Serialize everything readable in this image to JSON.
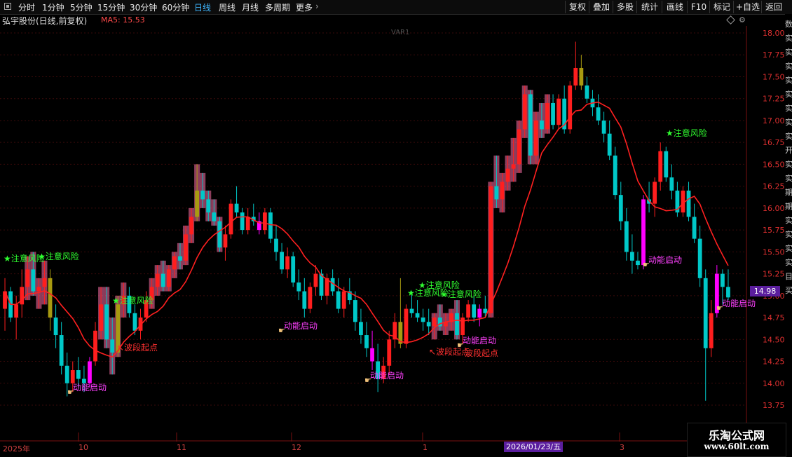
{
  "toolbar": {
    "periods": [
      "分时",
      "1分钟",
      "5分钟",
      "15分钟",
      "30分钟",
      "60分钟",
      "日线",
      "周线",
      "月线",
      "多周期",
      "更多"
    ],
    "active_period": "日线",
    "right_buttons": [
      "复权",
      "叠加",
      "多股",
      "统计",
      "画线",
      "F10",
      "标记",
      "+自选",
      "返回"
    ]
  },
  "stock": {
    "title": "弘宇股份(日线,前复权)",
    "ma_label": "MA5: 15.53",
    "var_label": "VAR1"
  },
  "current_price": "14.98",
  "current_date": "2026/01/23/五",
  "x_axis": [
    "2025年",
    "10",
    "11",
    "12",
    "1",
    "2026/01/23/五",
    "3"
  ],
  "signals": {
    "risk": "★注意风险",
    "start": "动能启动",
    "wave": "↖波段起点",
    "wave2": "波段起点"
  },
  "watermark": {
    "title": "乐淘公式网",
    "url": "www.60lt.com"
  },
  "right_strip_chars": [
    "数",
    "实",
    "实",
    "实",
    "实",
    "实",
    "实",
    "实",
    "实",
    "开",
    "实",
    "实",
    "期",
    "期",
    "实",
    "实",
    "实",
    "实",
    "目",
    "买"
  ],
  "colors": {
    "up": "#ff1e1e",
    "down": "#00c8c8",
    "pink": "#ff6fa8",
    "olive": "#a89a10",
    "magenta": "#ff00ff",
    "ma": "#ff2020",
    "grid": "#3a0a0a"
  },
  "chart_data": {
    "type": "candlestick",
    "y_axis_ticks": [
      18.0,
      17.75,
      17.5,
      17.25,
      17.0,
      16.75,
      16.5,
      16.25,
      16.0,
      15.75,
      15.5,
      15.25,
      15.0,
      14.75,
      14.5,
      14.25,
      14.0,
      13.75
    ],
    "ylim": [
      13.6,
      18.1
    ],
    "series": [
      {
        "name": "MA5"
      }
    ],
    "candles": [
      [
        14.85,
        15.2,
        14.6,
        15.05
      ],
      [
        15.05,
        15.1,
        14.7,
        14.75
      ],
      [
        14.75,
        15.0,
        14.5,
        14.9
      ],
      [
        14.9,
        15.3,
        14.75,
        15.1
      ],
      [
        15.1,
        15.45,
        14.95,
        15.3
      ],
      [
        15.3,
        15.5,
        15.0,
        15.05
      ],
      [
        15.05,
        15.2,
        14.85,
        15.1
      ],
      [
        15.1,
        15.4,
        14.9,
        15.2
      ],
      [
        15.2,
        15.3,
        14.6,
        14.75
      ],
      [
        14.75,
        14.9,
        14.4,
        14.55
      ],
      [
        14.55,
        14.7,
        14.1,
        14.2
      ],
      [
        14.2,
        14.35,
        13.85,
        14.0
      ],
      [
        14.0,
        14.25,
        13.9,
        14.15
      ],
      [
        14.15,
        14.3,
        13.95,
        14.05
      ],
      [
        14.05,
        14.2,
        13.9,
        14.0
      ],
      [
        14.0,
        14.3,
        13.95,
        14.25
      ],
      [
        14.25,
        14.7,
        14.2,
        14.6
      ],
      [
        14.6,
        15.1,
        14.5,
        14.9
      ],
      [
        14.9,
        15.1,
        14.4,
        14.5
      ],
      [
        14.5,
        14.75,
        14.1,
        14.35
      ],
      [
        14.35,
        15.0,
        14.3,
        14.9
      ],
      [
        14.9,
        15.15,
        14.75,
        15.0
      ],
      [
        15.0,
        15.1,
        14.75,
        14.8
      ],
      [
        14.8,
        14.9,
        14.55,
        14.6
      ],
      [
        14.6,
        14.85,
        14.5,
        14.75
      ],
      [
        14.75,
        15.05,
        14.7,
        14.95
      ],
      [
        14.95,
        15.2,
        14.85,
        15.1
      ],
      [
        15.1,
        15.35,
        15.0,
        15.25
      ],
      [
        15.25,
        15.4,
        15.05,
        15.1
      ],
      [
        15.1,
        15.35,
        15.05,
        15.3
      ],
      [
        15.3,
        15.5,
        15.2,
        15.45
      ],
      [
        15.45,
        15.6,
        15.3,
        15.4
      ],
      [
        15.4,
        15.8,
        15.35,
        15.7
      ],
      [
        15.7,
        16.0,
        15.6,
        15.9
      ],
      [
        15.9,
        16.5,
        15.85,
        16.2
      ],
      [
        16.2,
        16.4,
        16.0,
        16.1
      ],
      [
        16.1,
        16.2,
        15.85,
        15.95
      ],
      [
        15.95,
        16.1,
        15.8,
        15.85
      ],
      [
        15.85,
        15.9,
        15.5,
        15.55
      ],
      [
        15.55,
        15.8,
        15.4,
        15.7
      ],
      [
        15.7,
        16.1,
        15.65,
        16.05
      ],
      [
        16.05,
        16.25,
        15.9,
        15.95
      ],
      [
        15.95,
        16.0,
        15.7,
        15.75
      ],
      [
        15.75,
        16.0,
        15.7,
        15.9
      ],
      [
        15.9,
        16.05,
        15.8,
        15.85
      ],
      [
        15.85,
        15.95,
        15.7,
        15.75
      ],
      [
        15.75,
        16.0,
        15.7,
        15.95
      ],
      [
        15.95,
        16.0,
        15.6,
        15.65
      ],
      [
        15.65,
        15.8,
        15.4,
        15.5
      ],
      [
        15.5,
        15.6,
        15.25,
        15.3
      ],
      [
        15.3,
        15.55,
        15.2,
        15.45
      ],
      [
        15.45,
        15.5,
        15.1,
        15.15
      ],
      [
        15.15,
        15.3,
        14.95,
        15.05
      ],
      [
        15.05,
        15.2,
        14.75,
        14.85
      ],
      [
        14.85,
        15.15,
        14.8,
        15.1
      ],
      [
        15.1,
        15.35,
        15.0,
        15.25
      ],
      [
        15.25,
        15.3,
        14.95,
        15.0
      ],
      [
        15.0,
        15.25,
        14.9,
        15.2
      ],
      [
        15.2,
        15.3,
        15.0,
        15.05
      ],
      [
        15.05,
        15.2,
        14.8,
        14.85
      ],
      [
        14.85,
        15.1,
        14.75,
        15.05
      ],
      [
        15.05,
        15.2,
        14.9,
        14.95
      ],
      [
        14.95,
        15.05,
        14.6,
        14.7
      ],
      [
        14.7,
        14.85,
        14.45,
        14.55
      ],
      [
        14.55,
        14.7,
        14.3,
        14.4
      ],
      [
        14.4,
        14.6,
        14.15,
        14.25
      ],
      [
        14.25,
        14.45,
        13.9,
        14.05
      ],
      [
        14.05,
        14.3,
        14.0,
        14.2
      ],
      [
        14.2,
        14.6,
        14.1,
        14.5
      ],
      [
        14.5,
        14.8,
        14.4,
        14.7
      ],
      [
        14.7,
        15.2,
        14.4,
        14.45
      ],
      [
        14.45,
        14.9,
        14.4,
        14.85
      ],
      [
        14.85,
        15.05,
        14.75,
        14.8
      ],
      [
        14.8,
        14.95,
        14.7,
        14.75
      ],
      [
        14.75,
        14.85,
        14.6,
        14.7
      ],
      [
        14.7,
        14.85,
        14.55,
        14.65
      ],
      [
        14.65,
        14.8,
        14.5,
        14.75
      ],
      [
        14.75,
        14.9,
        14.6,
        14.65
      ],
      [
        14.65,
        14.8,
        14.55,
        14.7
      ],
      [
        14.7,
        14.85,
        14.6,
        14.8
      ],
      [
        14.8,
        14.95,
        14.5,
        14.55
      ],
      [
        14.55,
        14.8,
        14.45,
        14.75
      ],
      [
        14.75,
        14.95,
        14.7,
        14.9
      ],
      [
        14.9,
        15.0,
        14.7,
        14.75
      ],
      [
        14.75,
        14.9,
        14.65,
        14.85
      ],
      [
        14.85,
        15.0,
        14.75,
        14.8
      ],
      [
        14.8,
        16.3,
        14.75,
        16.25
      ],
      [
        16.25,
        16.6,
        16.0,
        16.1
      ],
      [
        16.1,
        16.4,
        15.95,
        16.3
      ],
      [
        16.3,
        16.6,
        16.2,
        16.45
      ],
      [
        16.45,
        16.8,
        16.3,
        16.5
      ],
      [
        16.5,
        17.0,
        16.4,
        16.9
      ],
      [
        16.9,
        17.4,
        16.8,
        17.3
      ],
      [
        17.3,
        17.35,
        16.5,
        16.6
      ],
      [
        16.6,
        17.1,
        16.5,
        17.0
      ],
      [
        17.0,
        17.2,
        16.8,
        16.9
      ],
      [
        16.9,
        17.3,
        16.85,
        17.2
      ],
      [
        17.2,
        17.3,
        16.9,
        16.95
      ],
      [
        16.95,
        17.3,
        16.9,
        17.25
      ],
      [
        17.25,
        17.4,
        16.85,
        16.9
      ],
      [
        16.9,
        17.45,
        16.85,
        17.4
      ],
      [
        17.4,
        17.9,
        17.35,
        17.6
      ],
      [
        17.6,
        17.75,
        17.35,
        17.4
      ],
      [
        17.4,
        17.5,
        17.2,
        17.25
      ],
      [
        17.25,
        17.35,
        17.05,
        17.15
      ],
      [
        17.15,
        17.3,
        16.95,
        17.0
      ],
      [
        17.0,
        17.1,
        16.75,
        16.85
      ],
      [
        16.85,
        17.0,
        16.55,
        16.6
      ],
      [
        16.6,
        16.7,
        16.1,
        16.15
      ],
      [
        16.15,
        16.3,
        15.75,
        15.85
      ],
      [
        15.85,
        16.0,
        15.4,
        15.5
      ],
      [
        15.5,
        15.7,
        15.25,
        15.4
      ],
      [
        15.4,
        15.5,
        15.3,
        15.35
      ],
      [
        15.35,
        16.15,
        15.3,
        16.1
      ],
      [
        16.1,
        16.3,
        15.95,
        16.05
      ],
      [
        16.05,
        16.35,
        15.9,
        16.3
      ],
      [
        16.3,
        16.75,
        16.2,
        16.65
      ],
      [
        16.65,
        16.7,
        16.3,
        16.35
      ],
      [
        16.35,
        16.5,
        16.1,
        16.2
      ],
      [
        16.2,
        16.3,
        15.9,
        15.95
      ],
      [
        15.95,
        16.25,
        15.9,
        16.2
      ],
      [
        16.2,
        16.3,
        15.85,
        15.9
      ],
      [
        15.9,
        16.05,
        15.6,
        15.65
      ],
      [
        15.65,
        15.8,
        15.1,
        15.2
      ],
      [
        15.2,
        15.3,
        13.8,
        14.4
      ],
      [
        14.4,
        14.95,
        14.3,
        14.8
      ],
      [
        14.8,
        15.35,
        14.75,
        15.25
      ],
      [
        15.25,
        15.3,
        14.9,
        15.1
      ],
      [
        15.1,
        15.3,
        14.95,
        14.98
      ]
    ]
  }
}
